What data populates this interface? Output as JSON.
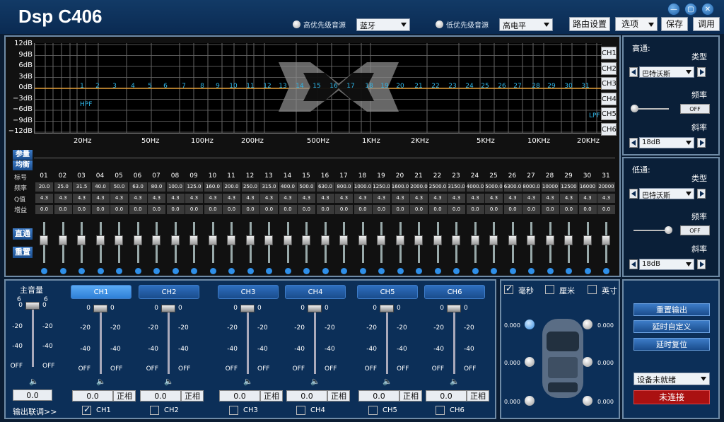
{
  "header": {
    "title": "Dsp C406",
    "high_label": "高优先级音源",
    "high_value": "蓝牙",
    "low_label": "低优先级音源",
    "low_value": "高电平",
    "buttons": [
      "路由设置",
      "选项",
      "保存",
      "调用"
    ],
    "win": [
      "—",
      "▢",
      "✕"
    ]
  },
  "graph": {
    "y_labels": [
      "12dB",
      "9dB",
      "6dB",
      "3dB",
      "0dB",
      "−3dB",
      "−6dB",
      "−9dB",
      "−12dB"
    ],
    "x_labels": [
      "20Hz",
      "50Hz",
      "100Hz",
      "200Hz",
      "500Hz",
      "1KHz",
      "2KHz",
      "5KHz",
      "10KHz",
      "20KHz"
    ],
    "hpf": "HPF",
    "lpf": "LPF",
    "channels": [
      "CH1",
      "CH2",
      "CH3",
      "CH4",
      "CH5",
      "CH6"
    ]
  },
  "eq": {
    "peq_label": "参量",
    "eq_label": "均衡",
    "rows": [
      "标号",
      "频率",
      "Q值",
      "增益"
    ],
    "bypass": "直通",
    "reset": "重置",
    "bands": [
      "01",
      "02",
      "03",
      "04",
      "05",
      "06",
      "07",
      "08",
      "09",
      "10",
      "11",
      "12",
      "13",
      "14",
      "15",
      "16",
      "17",
      "18",
      "19",
      "20",
      "21",
      "22",
      "23",
      "24",
      "25",
      "26",
      "27",
      "28",
      "29",
      "30",
      "31"
    ],
    "freqs": [
      "20.0",
      "25.0",
      "31.5",
      "40.0",
      "50.0",
      "63.0",
      "80.0",
      "100.0",
      "125.0",
      "160.0",
      "200.0",
      "250.0",
      "315.0",
      "400.0",
      "500.0",
      "630.0",
      "800.0",
      "1000.0",
      "1250.0",
      "1600.0",
      "2000.0",
      "2500.0",
      "3150.0",
      "4000.0",
      "5000.0",
      "6300.0",
      "8000.0",
      "10000",
      "12500",
      "16000",
      "20000"
    ],
    "q": "4.3",
    "gain": "0.0"
  },
  "high": {
    "title": "高通:",
    "type_label": "类型",
    "type": "巴特沃斯",
    "freq_label": "频率",
    "freq": "OFF",
    "slope_label": "斜率",
    "slope": "18dB"
  },
  "low": {
    "title": "低通:",
    "type_label": "类型",
    "type": "巴特沃斯",
    "freq_label": "频率",
    "freq": "OFF",
    "slope_label": "斜率",
    "slope": "18dB"
  },
  "master": {
    "label": "主音量",
    "value": "0.0",
    "link": "输出联调>>",
    "top": "6",
    "ticks": [
      "0",
      "-20",
      "-40",
      "OFF"
    ]
  },
  "channels": [
    {
      "name": "CH1",
      "value": "0.0",
      "phase": "正相",
      "check": "CH1",
      "checked": true
    },
    {
      "name": "CH2",
      "value": "0.0",
      "phase": "正相",
      "check": "CH2",
      "checked": false
    },
    {
      "name": "CH3",
      "value": "0.0",
      "phase": "正相",
      "check": "CH3",
      "checked": false
    },
    {
      "name": "CH4",
      "value": "0.0",
      "phase": "正相",
      "check": "CH4",
      "checked": false
    },
    {
      "name": "CH5",
      "value": "0.0",
      "phase": "正相",
      "check": "CH5",
      "checked": false
    },
    {
      "name": "CH6",
      "value": "0.0",
      "phase": "正相",
      "check": "CH6",
      "checked": false
    }
  ],
  "vticks": [
    "0",
    "-20",
    "-40",
    "OFF"
  ],
  "delay": {
    "units": [
      "毫秒",
      "厘米",
      "英寸"
    ],
    "values": [
      "0.000",
      "0.000",
      "0.000",
      "0.000",
      "0.000",
      "0.000"
    ]
  },
  "control": {
    "reset_out": "重置输出",
    "delay_custom": "延时自定义",
    "delay_reset": "延时复位",
    "device": "设备未就绪",
    "connect": "未连接"
  }
}
